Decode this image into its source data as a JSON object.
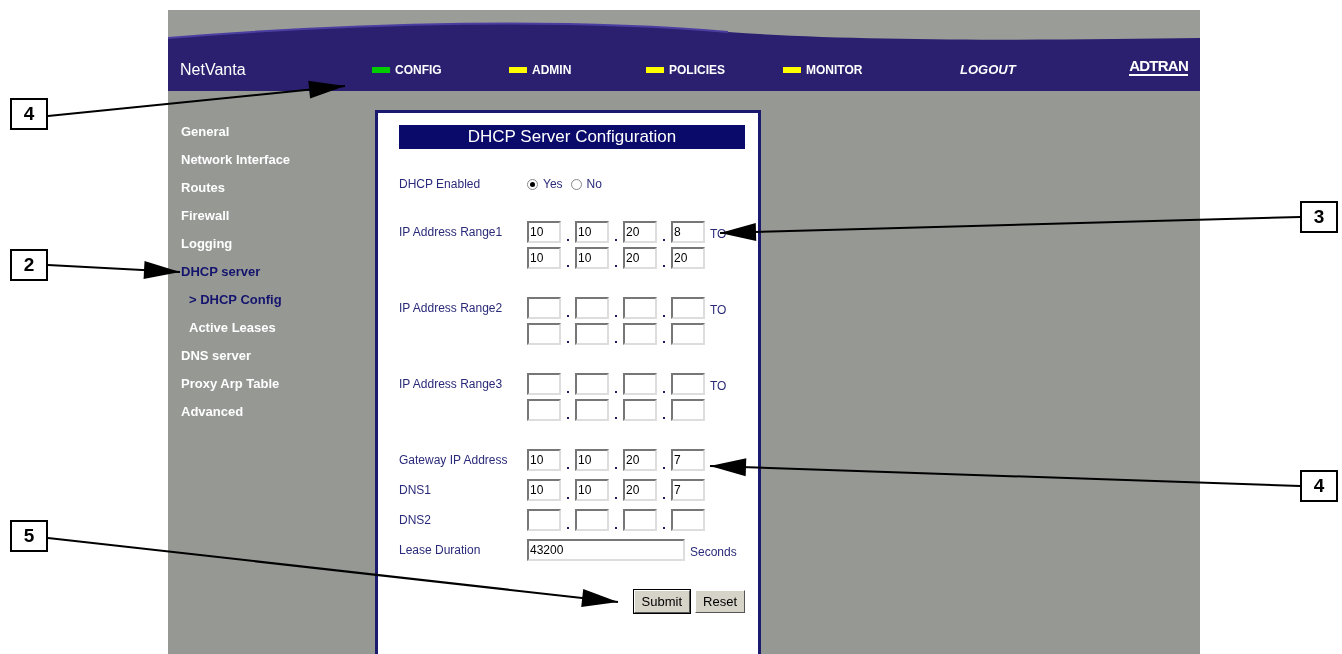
{
  "header": {
    "brand": "NetVanta",
    "logo": "ADTRAN",
    "logout": "LOGOUT"
  },
  "nav": [
    {
      "label": "CONFIG",
      "color": "#00cc00"
    },
    {
      "label": "ADMIN",
      "color": "#ffff00"
    },
    {
      "label": "POLICIES",
      "color": "#ffff00"
    },
    {
      "label": "MONITOR",
      "color": "#ffff00"
    }
  ],
  "sidebar": {
    "items": [
      {
        "label": "General",
        "selected": false
      },
      {
        "label": "Network Interface",
        "selected": false
      },
      {
        "label": "Routes",
        "selected": false
      },
      {
        "label": "Firewall",
        "selected": false
      },
      {
        "label": "Logging",
        "selected": false
      },
      {
        "label": "DHCP server",
        "selected": true,
        "children": [
          {
            "label": "> DHCP Config",
            "selected": true
          },
          {
            "label": "Active Leases",
            "selected": false
          }
        ]
      },
      {
        "label": "DNS server",
        "selected": false
      },
      {
        "label": "Proxy Arp Table",
        "selected": false
      },
      {
        "label": "Advanced",
        "selected": false
      }
    ]
  },
  "form": {
    "title": "DHCP Server Configuration",
    "rows": [
      {
        "kind": "radio",
        "label": "DHCP Enabled",
        "options": [
          {
            "label": "Yes",
            "selected": true
          },
          {
            "label": "No",
            "selected": false
          }
        ]
      },
      {
        "kind": "range",
        "label": "IP Address Range1",
        "to": "TO",
        "start": [
          "10",
          "10",
          "20",
          "8"
        ],
        "end": [
          "10",
          "10",
          "20",
          "20"
        ]
      },
      {
        "kind": "range",
        "label": "IP Address Range2",
        "to": "TO"
      },
      {
        "kind": "range",
        "label": "IP Address Range3",
        "to": "TO"
      },
      {
        "kind": "ip",
        "label": "Gateway IP Address",
        "octets": [
          "10",
          "10",
          "20",
          "7"
        ]
      },
      {
        "kind": "ip",
        "label": "DNS1",
        "octets": [
          "10",
          "10",
          "20",
          "7"
        ]
      },
      {
        "kind": "ip",
        "label": "DNS2"
      },
      {
        "kind": "text",
        "label": "Lease Duration",
        "value": "43200",
        "unit": "Seconds"
      }
    ],
    "buttons": [
      "Submit",
      "Reset"
    ]
  },
  "callouts": [
    {
      "number": "4"
    },
    {
      "number": "2"
    },
    {
      "number": "5"
    },
    {
      "number": "3"
    },
    {
      "number": "4"
    }
  ]
}
